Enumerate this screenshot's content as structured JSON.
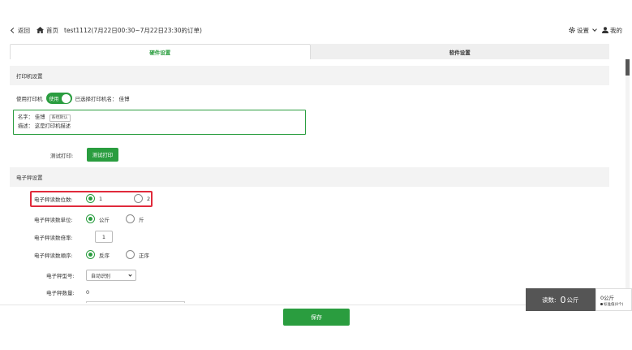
{
  "nav": {
    "back_label": "返回",
    "home_label": "首页",
    "title": "test1112(7月22日00:30~7月22日23:30的订单)",
    "settings_label": "设置",
    "mine_label": "我的"
  },
  "tabs": [
    {
      "label": "硬件设置",
      "active": true
    },
    {
      "label": "软件设置",
      "active": false
    }
  ],
  "printer": {
    "section_title": "打印机设置",
    "use_label": "使用打印机",
    "toggle_label": "使用",
    "selected_label": "已选择打印机名：",
    "selected_name": "佳博",
    "name_label": "名字：",
    "name_value": "佳博",
    "default_tag": "系统默认",
    "desc_label": "描述：",
    "desc_value": "这是打印机描述",
    "test_label": "测试打印:",
    "test_button": "测试打印"
  },
  "scale": {
    "section_title": "电子秤设置",
    "decimal_label": "电子秤读数位数:",
    "decimal_options": [
      "1",
      "2"
    ],
    "decimal_selected": "1",
    "unit_label": "电子秤读数单位:",
    "unit_options": [
      "公斤",
      "斤"
    ],
    "unit_selected": "公斤",
    "multiplier_label": "电子秤读数倍率:",
    "multiplier_value": "1",
    "order_label": "电子秤读数顺序:",
    "order_options": [
      "反序",
      "正序"
    ],
    "order_selected": "反序",
    "model_label": "电子秤型号:",
    "model_value": "自动识别",
    "count_label": "电子秤数量:",
    "count_value": "0"
  },
  "footer": {
    "save_button": "保存"
  },
  "weight_widget": {
    "reading_label": "读数:",
    "reading_value": "0",
    "reading_unit": "公斤",
    "side_value": "0公斤",
    "side_note": "标准值(0个)"
  },
  "colors": {
    "accent": "#2a9d3f",
    "highlight": "#e02a3b"
  }
}
